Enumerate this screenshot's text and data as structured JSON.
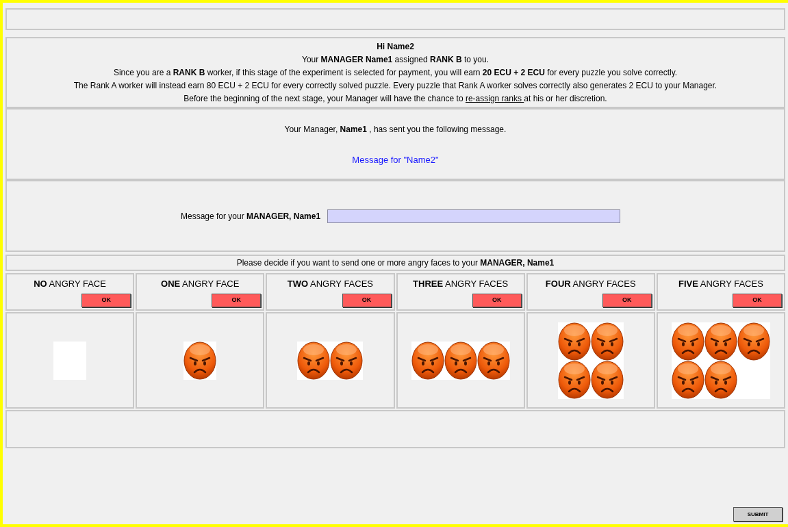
{
  "info": {
    "greeting": "Hi Name2",
    "lines": [
      "Your **MANAGER Name1** assigned **RANK B** to you.",
      "Since you are a **RANK B** worker, if this stage of the experiment is selected for payment, you will earn **20 ECU + 2 ECU** for every puzzle you solve correctly.",
      "The Rank A worker will instead earn 80 ECU + 2 ECU for every correctly solved puzzle. Every puzzle that Rank A worker solves correctly also generates 2 ECU to your Manager."
    ],
    "last_line": {
      "before": "Before the beginning of the next stage, your Manager will have the chance to",
      "link": "re-assign ranks ",
      "after": "at his or her discretion."
    }
  },
  "received": {
    "intro": "Your Manager, **Name1** , has sent you the following message.",
    "message": "Message for \"Name2\""
  },
  "reply": {
    "label": "Message for your **MANAGER, Name1**"
  },
  "decision": {
    "prompt": "Please decide if you want to send one or more angry faces to your **MANAGER, Name1**",
    "options": [
      {
        "label": "**NO** ANGRY FACE",
        "button": "OK",
        "image": {
          "kind": "blank"
        }
      },
      {
        "label": "**ONE** ANGRY FACE",
        "button": "OK",
        "image": {
          "kind": "faces",
          "rows": [
            [
              {
                "kind": "angry"
              }
            ]
          ]
        }
      },
      {
        "label": "**TWO** ANGRY FACES",
        "button": "OK",
        "image": {
          "kind": "faces",
          "rows": [
            [
              {
                "kind": "angry"
              },
              {
                "kind": "angry"
              }
            ]
          ]
        }
      },
      {
        "label": "**THREE** ANGRY FACES",
        "button": "OK",
        "image": {
          "kind": "faces",
          "rows": [
            [
              {
                "kind": "angry"
              },
              {
                "kind": "angry"
              },
              {
                "kind": "angry"
              }
            ]
          ]
        }
      },
      {
        "label": "**FOUR** ANGRY FACES",
        "button": "OK",
        "image": {
          "kind": "faces",
          "rows": [
            [
              {
                "kind": "angry"
              },
              {
                "kind": "angry"
              }
            ],
            [
              {
                "kind": "angry"
              },
              {
                "kind": "angry"
              }
            ]
          ]
        }
      },
      {
        "label": "**FIVE** ANGRY FACES",
        "button": "OK",
        "image": {
          "kind": "faces",
          "rows": [
            [
              {
                "kind": "angry"
              },
              {
                "kind": "angry"
              },
              {
                "kind": "angry"
              }
            ],
            [
              {
                "kind": "angry"
              },
              {
                "kind": "angry"
              }
            ]
          ]
        }
      }
    ]
  },
  "submit": "SUBMIT"
}
